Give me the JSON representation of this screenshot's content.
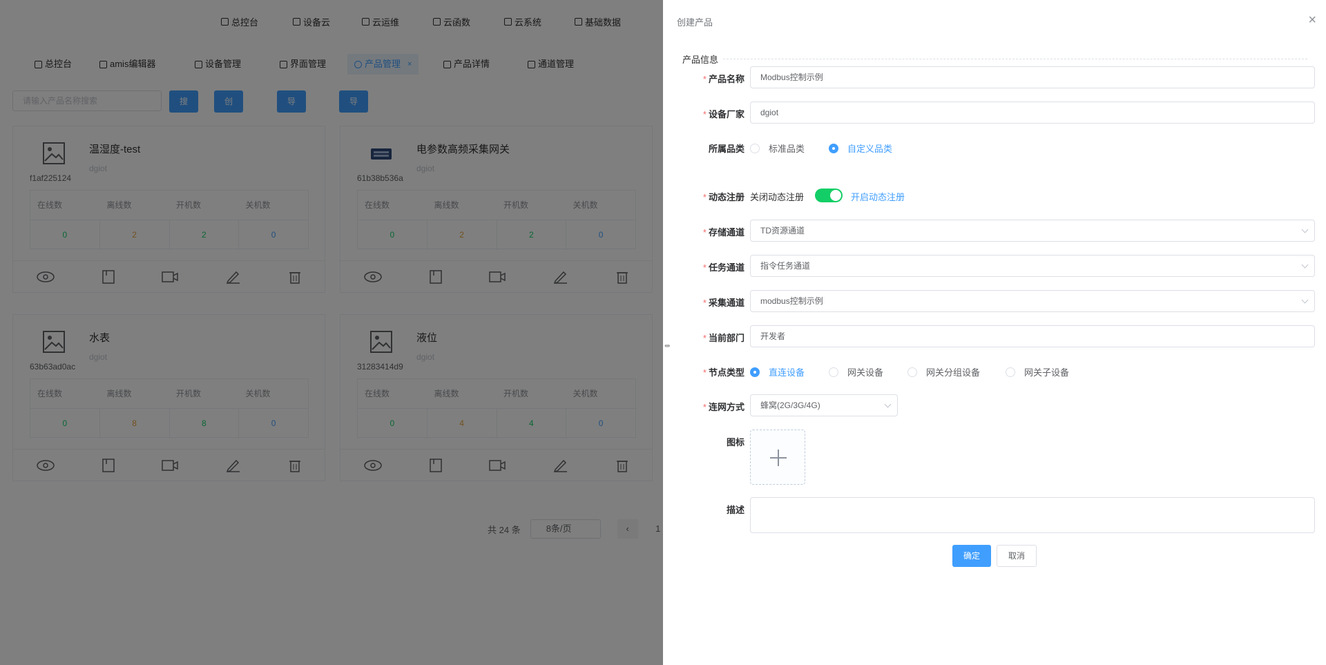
{
  "topnav": [
    {
      "label": "总控台",
      "icon": "home-icon"
    },
    {
      "label": "设备云",
      "icon": "device-icon"
    },
    {
      "label": "云运维",
      "icon": "cloud-ops-icon"
    },
    {
      "label": "云函数",
      "icon": "cloud-function-icon"
    },
    {
      "label": "云系统",
      "icon": "cloud-system-icon"
    },
    {
      "label": "基础数据",
      "icon": "base-data-icon"
    }
  ],
  "tabs": [
    {
      "label": "总控台"
    },
    {
      "label": "amis编辑器"
    },
    {
      "label": "设备管理"
    },
    {
      "label": "界面管理"
    },
    {
      "label": "产品管理",
      "close": "×"
    },
    {
      "label": "产品详情"
    },
    {
      "label": "通道管理"
    }
  ],
  "toolbar": {
    "search_placeholder": "请输入产品名称搜索",
    "search_label": "搜索",
    "create_label": "创建产品",
    "export_label": "导出产品",
    "import_label": "导入产品"
  },
  "stat_headers": [
    "在线数",
    "离线数",
    "开机数",
    "关机数"
  ],
  "cards": [
    {
      "title": "温湿度-test",
      "vendor": "dgiot",
      "id": "f1af225124",
      "values": [
        "0",
        "2",
        "2",
        "0"
      ]
    },
    {
      "title": "电参数高频采集网关",
      "vendor": "dgiot",
      "id": "61b38b536a",
      "values": [
        "0",
        "2",
        "2",
        "0"
      ]
    },
    {
      "title": "水表",
      "vendor": "dgiot",
      "id": "63b63ad0ac",
      "values": [
        "0",
        "8",
        "8",
        "0"
      ]
    },
    {
      "title": "液位",
      "vendor": "dgiot",
      "id": "31283414d9",
      "values": [
        "0",
        "4",
        "4",
        "0"
      ]
    }
  ],
  "pager": {
    "total": "共 24 条",
    "page_size": "8条/页",
    "prev": "‹",
    "page": "1"
  },
  "drawer": {
    "title": "创建产品",
    "close": "×",
    "section": "产品信息",
    "fields": {
      "name": {
        "label": "产品名称",
        "value": "Modbus控制示例"
      },
      "vendor": {
        "label": "设备厂家",
        "value": "dgiot"
      },
      "category": {
        "label": "所属品类",
        "options": [
          "标准品类",
          "自定义品类"
        ]
      },
      "dynreg": {
        "label": "动态注册",
        "off": "关闭动态注册",
        "on": "开启动态注册"
      },
      "storage": {
        "label": "存储通道",
        "value": "TD资源通道"
      },
      "task": {
        "label": "任务通道",
        "value": "指令任务通道"
      },
      "collect": {
        "label": "采集通道",
        "value": "modbus控制示例"
      },
      "dept": {
        "label": "当前部门",
        "value": "开发者"
      },
      "nodetype": {
        "label": "节点类型",
        "options": [
          "直连设备",
          "网关设备",
          "网关分组设备",
          "网关子设备"
        ]
      },
      "network": {
        "label": "连网方式",
        "value": "蜂窝(2G/3G/4G)"
      },
      "icon": {
        "label": "图标"
      },
      "desc": {
        "label": "描述"
      }
    },
    "confirm": "确定",
    "cancel": "取消"
  },
  "colors": {
    "primary": "#409eff",
    "online": "#13ce66",
    "offline": "#e6a23c",
    "on": "#13ce66",
    "off": "#409eff"
  }
}
